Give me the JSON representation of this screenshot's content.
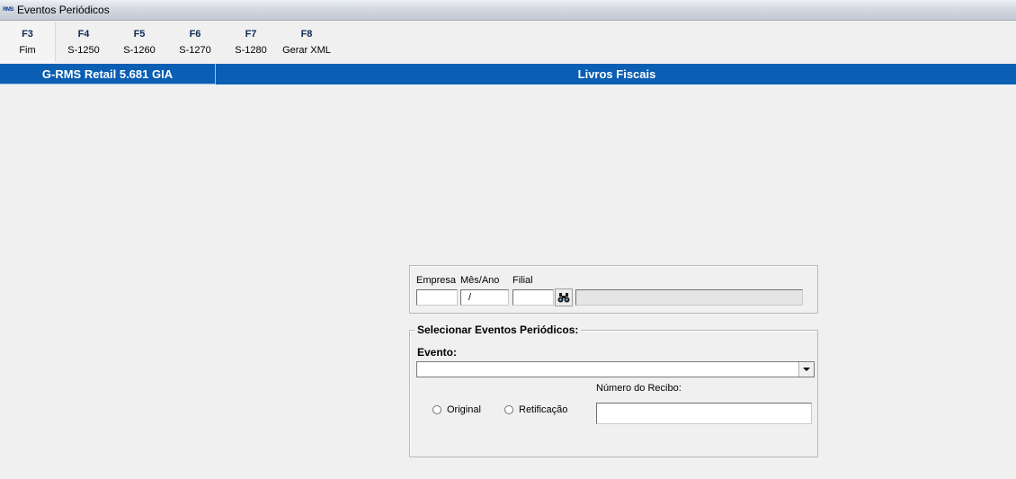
{
  "window": {
    "title": "Eventos Periódicos",
    "app_icon_text": "RMS"
  },
  "toolbar": {
    "buttons": [
      {
        "key": "F3",
        "label": "Fim"
      },
      {
        "key": "F4",
        "label": "S-1250"
      },
      {
        "key": "F5",
        "label": "S-1260"
      },
      {
        "key": "F6",
        "label": "S-1270"
      },
      {
        "key": "F7",
        "label": "S-1280"
      },
      {
        "key": "F8",
        "label": "Gerar XML"
      }
    ]
  },
  "header": {
    "product": "G-RMS Retail 5.681 GIA",
    "module": "Livros Fiscais"
  },
  "filter": {
    "empresa_label": "Empresa",
    "empresa_value": "",
    "mes_ano_label": "Mês/Ano",
    "mes_ano_value": "/",
    "filial_label": "Filial",
    "filial_value": "",
    "filial_description": ""
  },
  "events": {
    "group_title": "Selecionar Eventos Periódicos:",
    "evento_label": "Evento:",
    "evento_value": "",
    "radio_original": "Original",
    "radio_retificacao": "Retificação",
    "recibo_label": "Número do Recibo:",
    "recibo_value": ""
  },
  "colors": {
    "header_bar": "#0a5eb4",
    "toolbar_key": "#0f2b57"
  }
}
